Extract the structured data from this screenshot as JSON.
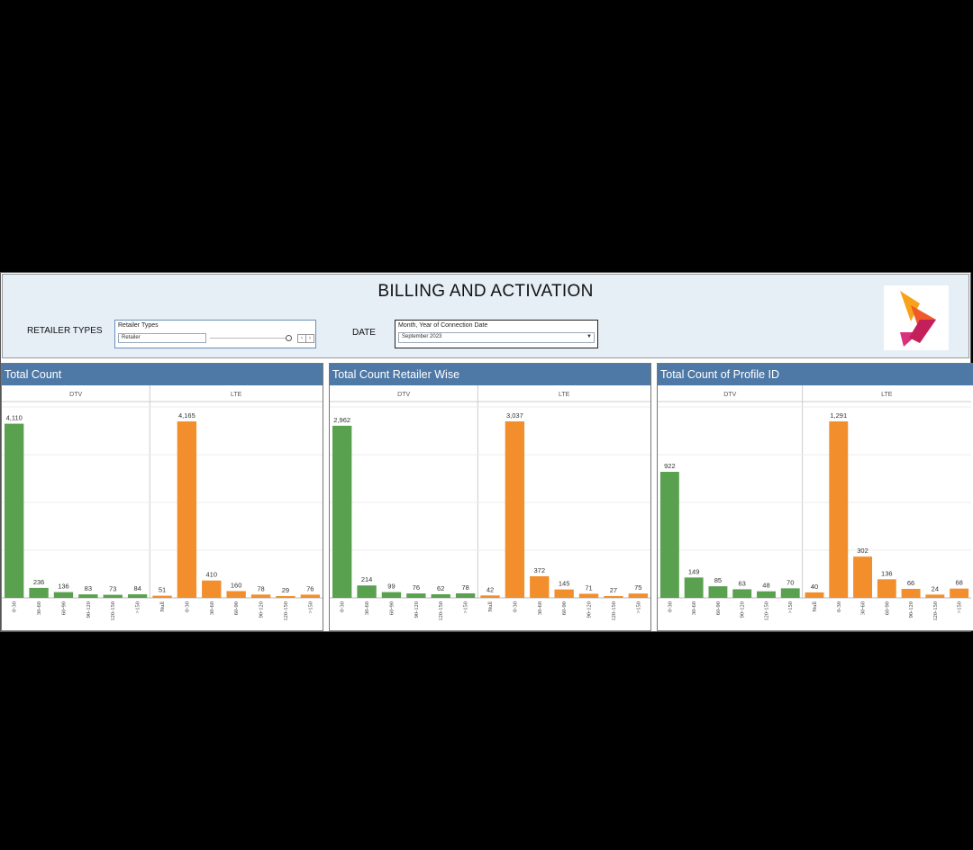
{
  "header": {
    "title": "BILLING AND ACTIVATION",
    "retailer_label": "RETAILER TYPES",
    "retailer_filter": {
      "caption": "Retailer Types",
      "value": "Retailer"
    },
    "date_label": "DATE",
    "date_filter": {
      "caption": "Month, Year of Connection Date",
      "value": "September 2023"
    }
  },
  "chart_data": [
    {
      "type": "bar",
      "title": "Total Count",
      "groups": [
        {
          "name": "DTV",
          "color": "#59a14f",
          "categories": [
            "0-30",
            "30-60",
            "60-90",
            "90-120",
            "120-150",
            ">150"
          ],
          "values": [
            4110,
            236,
            136,
            83,
            73,
            84
          ]
        },
        {
          "name": "LTE",
          "color": "#f28e2b",
          "categories": [
            "Null",
            "0-30",
            "30-60",
            "60-90",
            "90-120",
            "120-150",
            ">150"
          ],
          "values": [
            51,
            4165,
            410,
            160,
            78,
            29,
            76
          ]
        }
      ]
    },
    {
      "type": "bar",
      "title": "Total Count Retailer Wise",
      "groups": [
        {
          "name": "DTV",
          "color": "#59a14f",
          "categories": [
            "0-30",
            "30-60",
            "60-90",
            "90-120",
            "120-150",
            ">150"
          ],
          "values": [
            2962,
            214,
            99,
            76,
            62,
            78
          ]
        },
        {
          "name": "LTE",
          "color": "#f28e2b",
          "categories": [
            "Null",
            "0-30",
            "30-60",
            "60-90",
            "90-120",
            "120-150",
            ">150"
          ],
          "values": [
            42,
            3037,
            372,
            145,
            71,
            27,
            75
          ]
        }
      ]
    },
    {
      "type": "bar",
      "title": "Total Count of Profile ID",
      "groups": [
        {
          "name": "DTV",
          "color": "#59a14f",
          "categories": [
            "0-30",
            "30-60",
            "60-90",
            "90-120",
            "120-150",
            ">150"
          ],
          "values": [
            922,
            149,
            85,
            63,
            48,
            70
          ]
        },
        {
          "name": "LTE",
          "color": "#f28e2b",
          "categories": [
            "Null",
            "0-30",
            "30-60",
            "60-90",
            "90-120",
            "120-150",
            ">150"
          ],
          "values": [
            40,
            1291,
            302,
            136,
            66,
            24,
            68
          ]
        }
      ]
    }
  ]
}
